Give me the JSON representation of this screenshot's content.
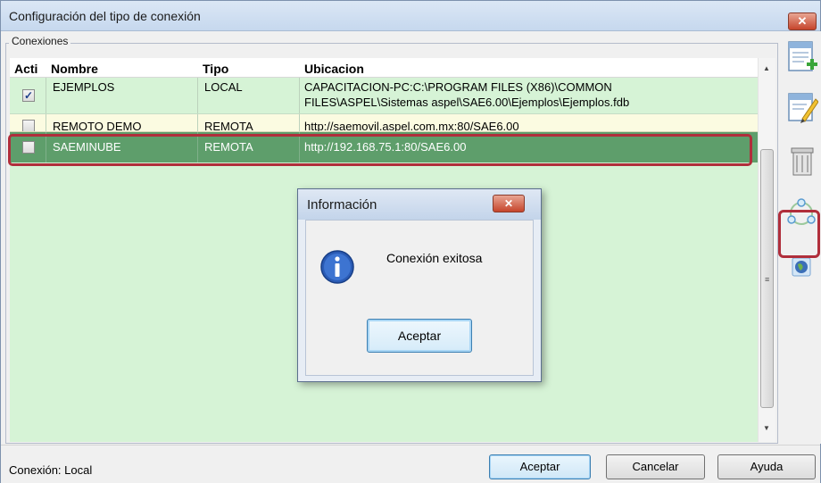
{
  "window": {
    "title": "Configuración del tipo de conexión",
    "close_glyph": "✕"
  },
  "group": {
    "label": "Conexiones"
  },
  "grid": {
    "columns": [
      "Acti",
      "Nombre",
      "Tipo",
      "Ubicacion"
    ],
    "rows": [
      {
        "active": true,
        "check": "✓",
        "nombre": "EJEMPLOS",
        "tipo": "LOCAL",
        "ubicacion_line1": "CAPACITACION-PC:C:\\PROGRAM FILES (X86)\\COMMON",
        "ubicacion_line2": "FILES\\ASPEL\\Sistemas aspel\\SAE6.00\\Ejemplos\\Ejemplos.fdb"
      },
      {
        "active": false,
        "check": "",
        "nombre": "REMOTO DEMO",
        "tipo": "REMOTA",
        "ubicacion": "http://saemovil.aspel.com.mx:80/SAE6.00"
      },
      {
        "active": false,
        "check": "",
        "nombre": "SAEMINUBE",
        "tipo": "REMOTA",
        "ubicacion": "http://192.168.75.1:80/SAE6.00",
        "selected": true
      }
    ]
  },
  "toolbar": {
    "icons": [
      "add-connection-icon",
      "edit-connection-icon",
      "delete-connection-icon",
      "test-connection-icon",
      "globe-icon"
    ]
  },
  "status": {
    "text": "Conexión: Local"
  },
  "buttons": {
    "accept": "Aceptar",
    "cancel": "Cancelar",
    "help": "Ayuda"
  },
  "dialog": {
    "title": "Información",
    "close_glyph": "✕",
    "message": "Conexión exitosa",
    "ok": "Aceptar"
  },
  "colors": {
    "grid_bg": "#d6f3d6",
    "selected_row": "#5e9e6b",
    "highlight": "#b02e3b"
  }
}
